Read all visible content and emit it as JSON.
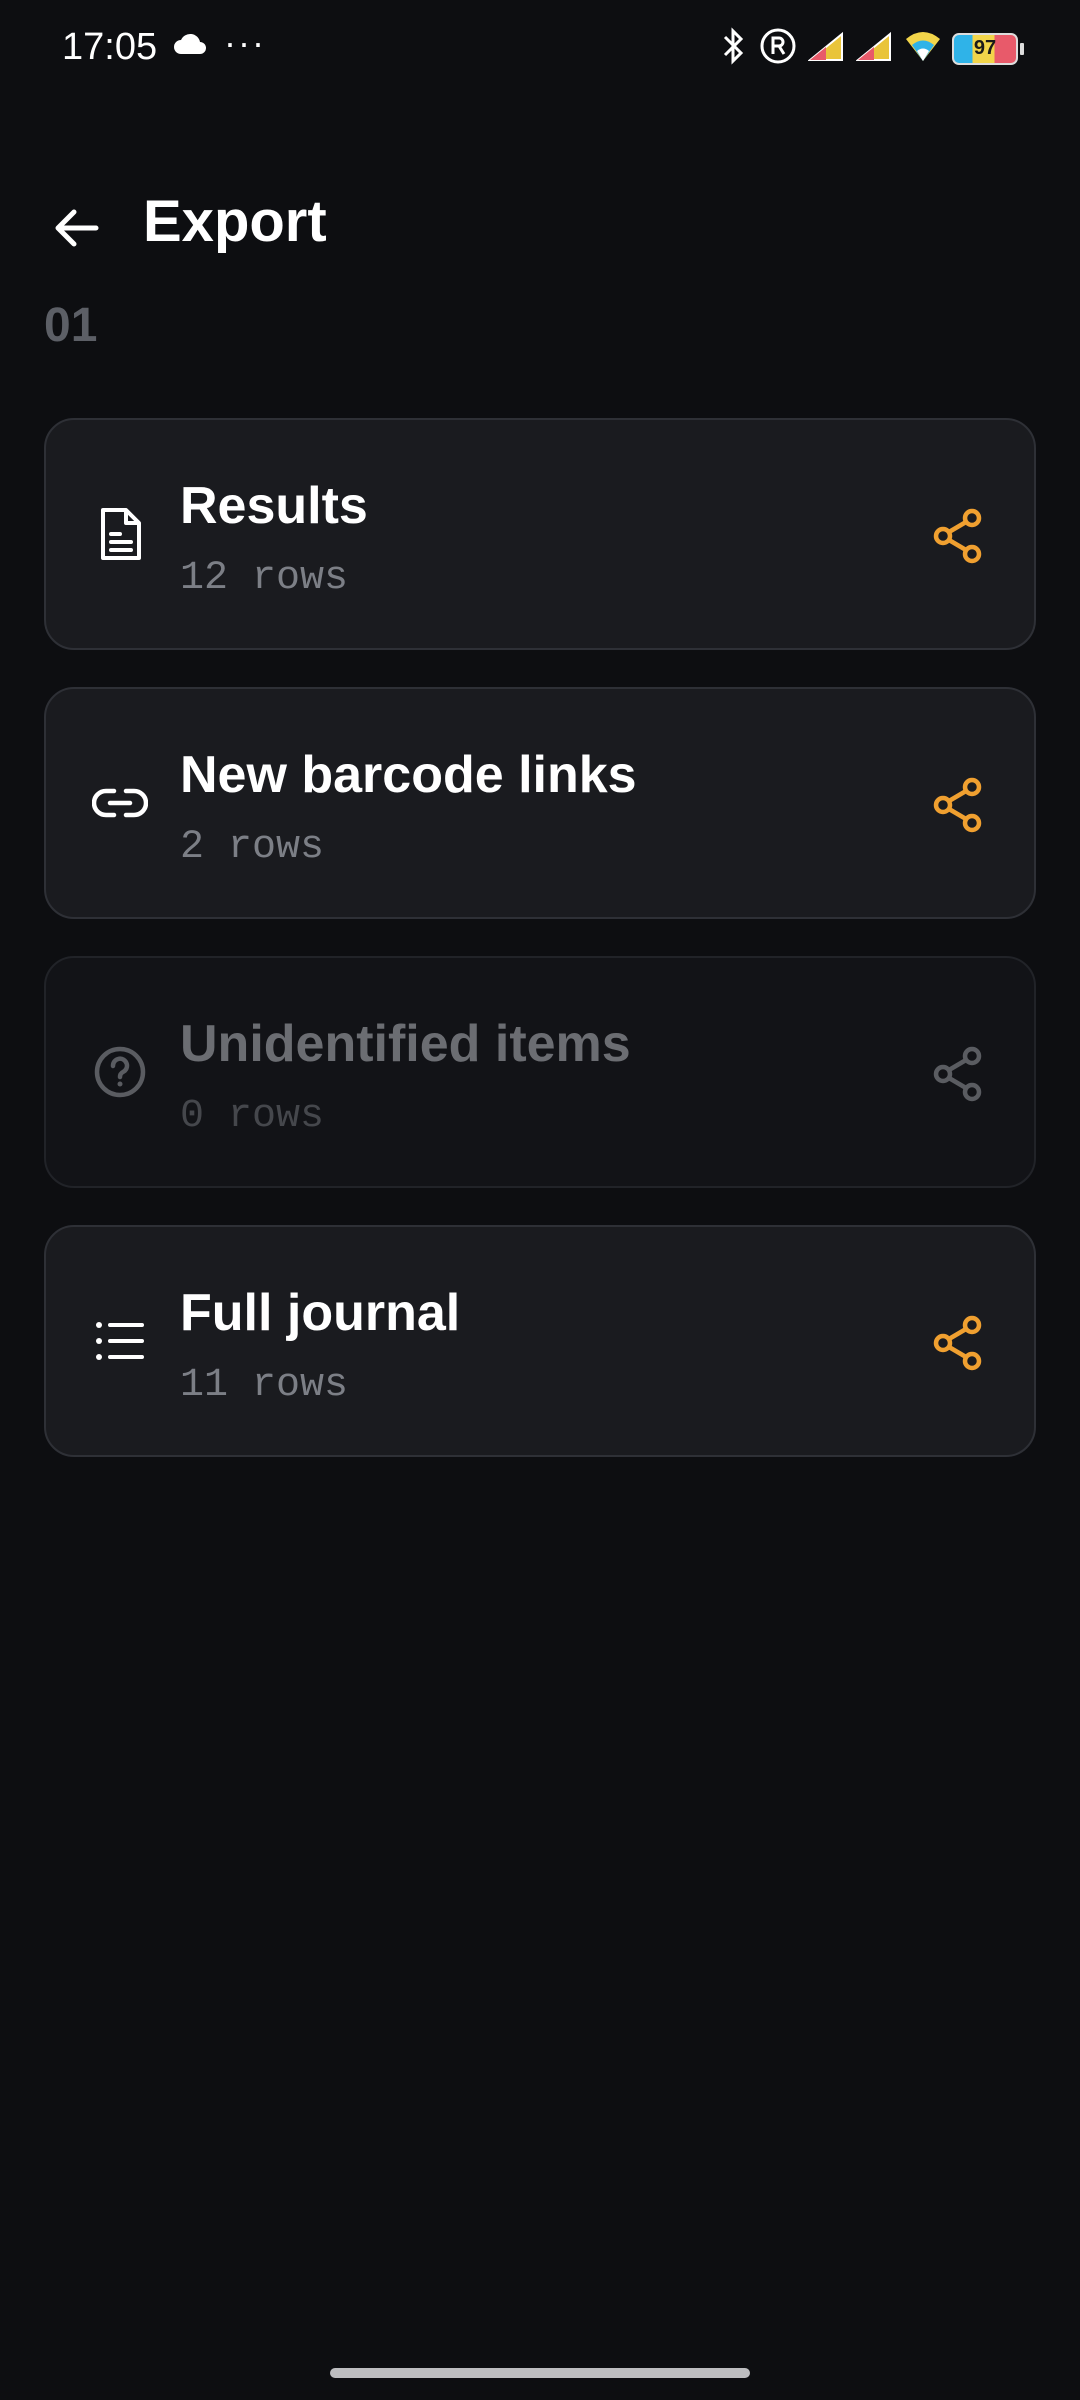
{
  "status": {
    "time": "17:05",
    "dots": "···",
    "battery": "97"
  },
  "header": {
    "title": "Export"
  },
  "section": {
    "label": "01"
  },
  "cards": [
    {
      "title": "Results",
      "subtitle": "12 rows",
      "icon": "document-icon",
      "enabled": true
    },
    {
      "title": "New barcode links",
      "subtitle": "2 rows",
      "icon": "link-icon",
      "enabled": true
    },
    {
      "title": "Unidentified items",
      "subtitle": "0 rows",
      "icon": "help-circle-icon",
      "enabled": false
    },
    {
      "title": "Full journal",
      "subtitle": "11 rows",
      "icon": "list-icon",
      "enabled": true
    }
  ],
  "colors": {
    "accent": "#f0a030",
    "background": "#0d0e11",
    "card": "#1a1b1f",
    "disabled": "#5a5c61"
  }
}
